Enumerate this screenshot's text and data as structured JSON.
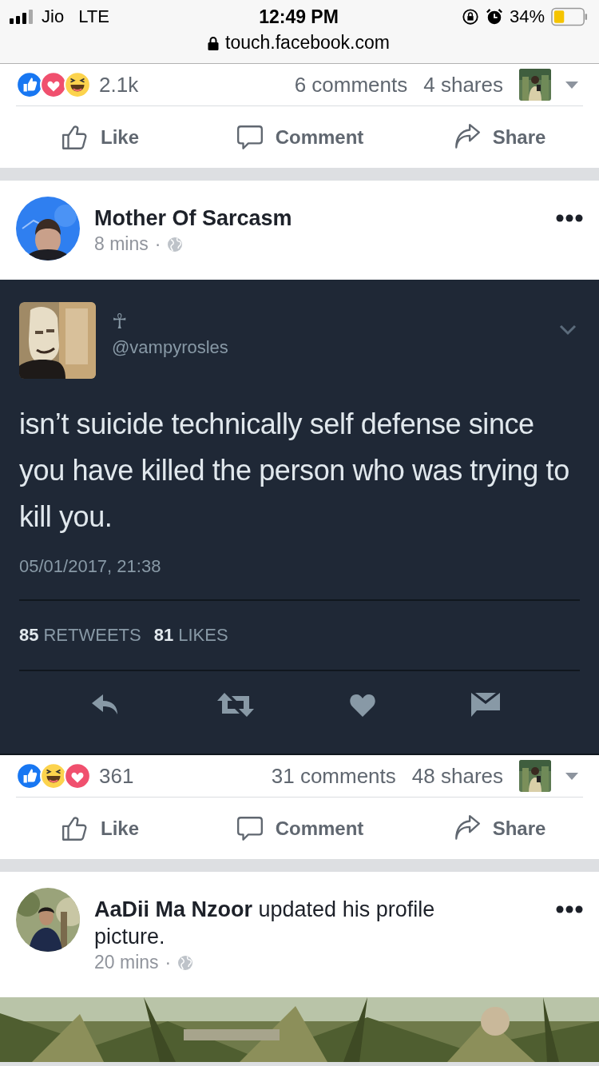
{
  "status_bar": {
    "carrier": "Jio",
    "network": "LTE",
    "time": "12:49 PM",
    "battery": "34%",
    "url": "touch.facebook.com"
  },
  "previous_post_footer": {
    "reactions": [
      {
        "kind": "like"
      },
      {
        "kind": "love"
      },
      {
        "kind": "haha"
      }
    ],
    "reaction_count": "2.1k",
    "comments": "6 comments",
    "shares": "4 shares",
    "actions": [
      {
        "kind": "like",
        "label": "Like"
      },
      {
        "kind": "comment",
        "label": "Comment"
      },
      {
        "kind": "share",
        "label": "Share"
      }
    ]
  },
  "post": {
    "author": "Mother Of Sarcasm",
    "time": "8 mins",
    "separator": "·",
    "tweet": {
      "display_name": "☥",
      "handle": "@vampyrosles",
      "text": "isn’t suicide technically self defense since you have killed the person who was trying to kill you.",
      "timestamp": "05/01/2017, 21:38",
      "retweets": "85",
      "retweets_label": "RETWEETS",
      "likes": "81",
      "likes_label": "LIKES"
    },
    "footer": {
      "reactions": [
        {
          "kind": "like"
        },
        {
          "kind": "haha"
        },
        {
          "kind": "love"
        }
      ],
      "reaction_count": "361",
      "comments": "31 comments",
      "shares": "48 shares",
      "actions": [
        {
          "kind": "like",
          "label": "Like"
        },
        {
          "kind": "comment",
          "label": "Comment"
        },
        {
          "kind": "share",
          "label": "Share"
        }
      ]
    }
  },
  "next_post": {
    "headline": "**AaDii Ma Nzoor** updated his profile picture.",
    "time": "20 mins",
    "separator": "·",
    "kind": "picture"
  }
}
